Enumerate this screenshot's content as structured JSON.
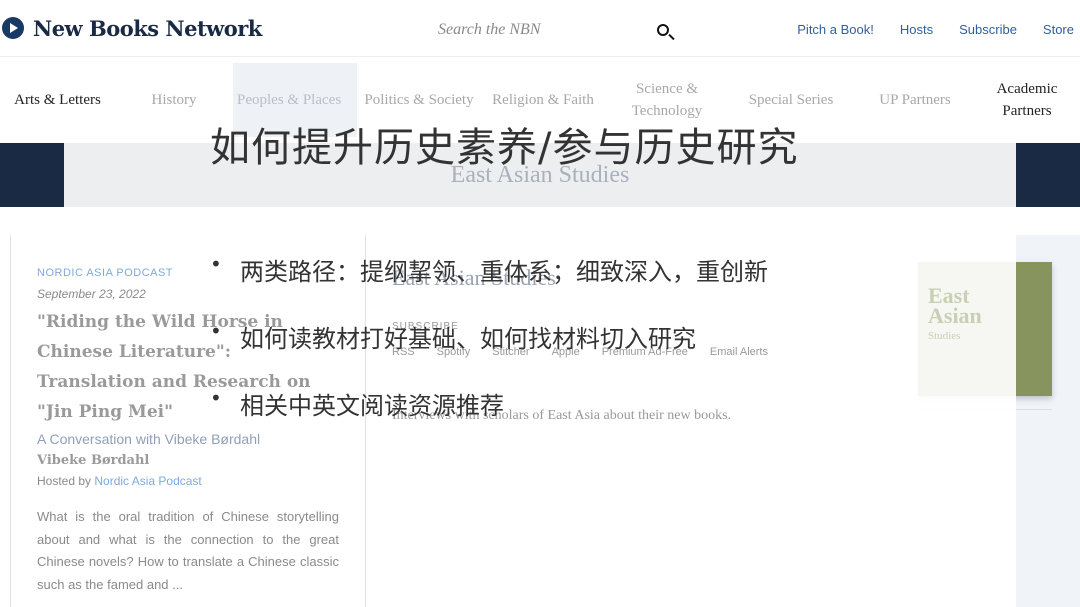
{
  "header": {
    "logo": "New Books Network",
    "search_placeholder": "Search the NBN",
    "links": [
      "Pitch a Book!",
      "Hosts",
      "Subscribe",
      "Store"
    ]
  },
  "nav": {
    "items": [
      "Arts & Letters",
      "History",
      "Peoples & Places",
      "Politics & Society",
      "Religion & Faith",
      "Science & Technology",
      "Special Series",
      "UP Partners",
      "Academic Partners"
    ],
    "active": "Peoples & Places"
  },
  "banner": {
    "title": "East Asian Studies"
  },
  "episode": {
    "podcast": "NORDIC ASIA PODCAST",
    "date": "September 23, 2022",
    "title": "\"Riding the Wild Horse in Chinese Literature\": Translation and Research on \"Jin Ping Mei\"",
    "subtitle": "A Conversation with Vibeke Børdahl",
    "guest": "Vibeke Børdahl",
    "hosted_prefix": "Hosted by ",
    "host": "Nordic Asia Podcast",
    "description": "What is the oral tradition of Chinese storytelling about and what is the connection to the great Chinese novels? How to translate a Chinese classic such as the famed and ..."
  },
  "channel": {
    "title": "East Asian Studies",
    "subscribe_label": "SUBSCRIBE",
    "platforms": [
      "RSS",
      "Spotify",
      "Stitcher",
      "Apple",
      "Premium Ad-Free",
      "Email Alerts"
    ],
    "description": "Interviews with scholars of East Asia about their new books.",
    "cover": {
      "line1": "East",
      "line2": "Asian",
      "line3": "Studies",
      "color": "#87945d"
    }
  },
  "slide": {
    "title": "如何提升历史素养/参与历史研究",
    "bullets": [
      "两类路径：提纲挈领、重体系；细致深入，重创新",
      "如何读教材打好基础、如何找材料切入研究",
      "相关中英文阅读资源推荐"
    ]
  }
}
